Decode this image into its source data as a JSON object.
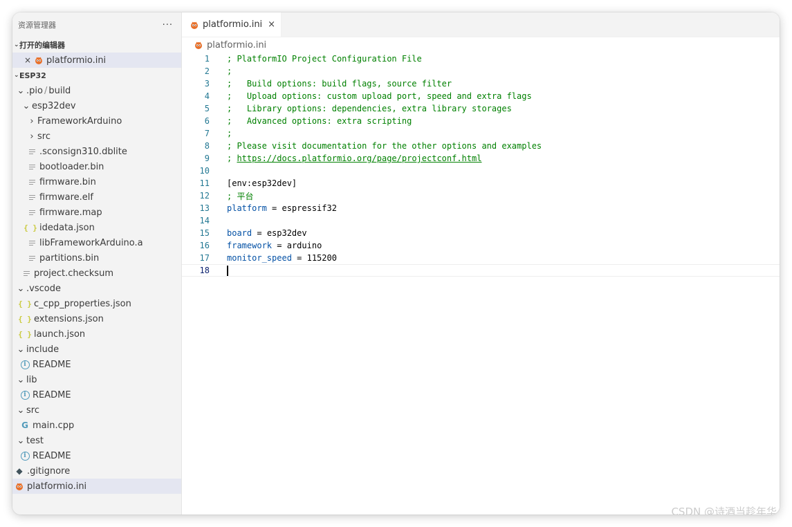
{
  "explorer": {
    "title": "资源管理器",
    "more": "···",
    "open_editors": {
      "title": "打开的编辑器",
      "items": [
        {
          "name": "platformio.ini",
          "close": "×"
        }
      ]
    },
    "workspace": {
      "title": "ESP32",
      "tree": [
        {
          "label_a": ".pio",
          "label_sep": "/",
          "label_b": "build"
        },
        {
          "label": "esp32dev"
        },
        {
          "label": "FrameworkArduino"
        },
        {
          "label": "src"
        },
        {
          "label": ".sconsign310.dblite"
        },
        {
          "label": "bootloader.bin"
        },
        {
          "label": "firmware.bin"
        },
        {
          "label": "firmware.elf"
        },
        {
          "label": "firmware.map"
        },
        {
          "label": "idedata.json"
        },
        {
          "label": "libFrameworkArduino.a"
        },
        {
          "label": "partitions.bin"
        },
        {
          "label": "project.checksum"
        },
        {
          "label": ".vscode"
        },
        {
          "label": "c_cpp_properties.json"
        },
        {
          "label": "extensions.json"
        },
        {
          "label": "launch.json"
        },
        {
          "label": "include"
        },
        {
          "label": "README"
        },
        {
          "label": "lib"
        },
        {
          "label": "README"
        },
        {
          "label": "src"
        },
        {
          "label": "main.cpp"
        },
        {
          "label": "test"
        },
        {
          "label": "README"
        },
        {
          "label": ".gitignore"
        },
        {
          "label": "platformio.ini"
        }
      ]
    }
  },
  "editor": {
    "tab": {
      "label": "platformio.ini",
      "close": "×"
    },
    "breadcrumb": "platformio.ini",
    "lines": [
      {
        "n": "1",
        "text": "; PlatformIO Project Configuration File"
      },
      {
        "n": "2",
        "text": ";"
      },
      {
        "n": "3",
        "text": ";   Build options: build flags, source filter"
      },
      {
        "n": "4",
        "text": ";   Upload options: custom upload port, speed and extra flags"
      },
      {
        "n": "5",
        "text": ";   Library options: dependencies, extra library storages"
      },
      {
        "n": "6",
        "text": ";   Advanced options: extra scripting"
      },
      {
        "n": "7",
        "text": ";"
      },
      {
        "n": "8",
        "text": "; Please visit documentation for the other options and examples"
      },
      {
        "n": "9",
        "prefix": "; ",
        "url": "https://docs.platformio.org/page/projectconf.html"
      },
      {
        "n": "10",
        "text": ""
      },
      {
        "n": "11",
        "section": "[env:esp32dev]"
      },
      {
        "n": "12",
        "text": "; 平台"
      },
      {
        "n": "13",
        "key": "platform",
        "eq": " = ",
        "val": "espressif32"
      },
      {
        "n": "14",
        "text": ""
      },
      {
        "n": "15",
        "key": "board",
        "eq": " = ",
        "val": "esp32dev"
      },
      {
        "n": "16",
        "key": "framework",
        "eq": " = ",
        "val": "arduino"
      },
      {
        "n": "17",
        "key": "monitor_speed",
        "eq": " = ",
        "val": "115200"
      },
      {
        "n": "18",
        "text": ""
      }
    ]
  },
  "watermark": "CSDN @诗酒当趁年华",
  "colors": {
    "comment": "#008000",
    "key": "#0451a5",
    "line_number": "#237893",
    "selection": "#e4e6f1",
    "platformio_brand": "#e8702a"
  }
}
